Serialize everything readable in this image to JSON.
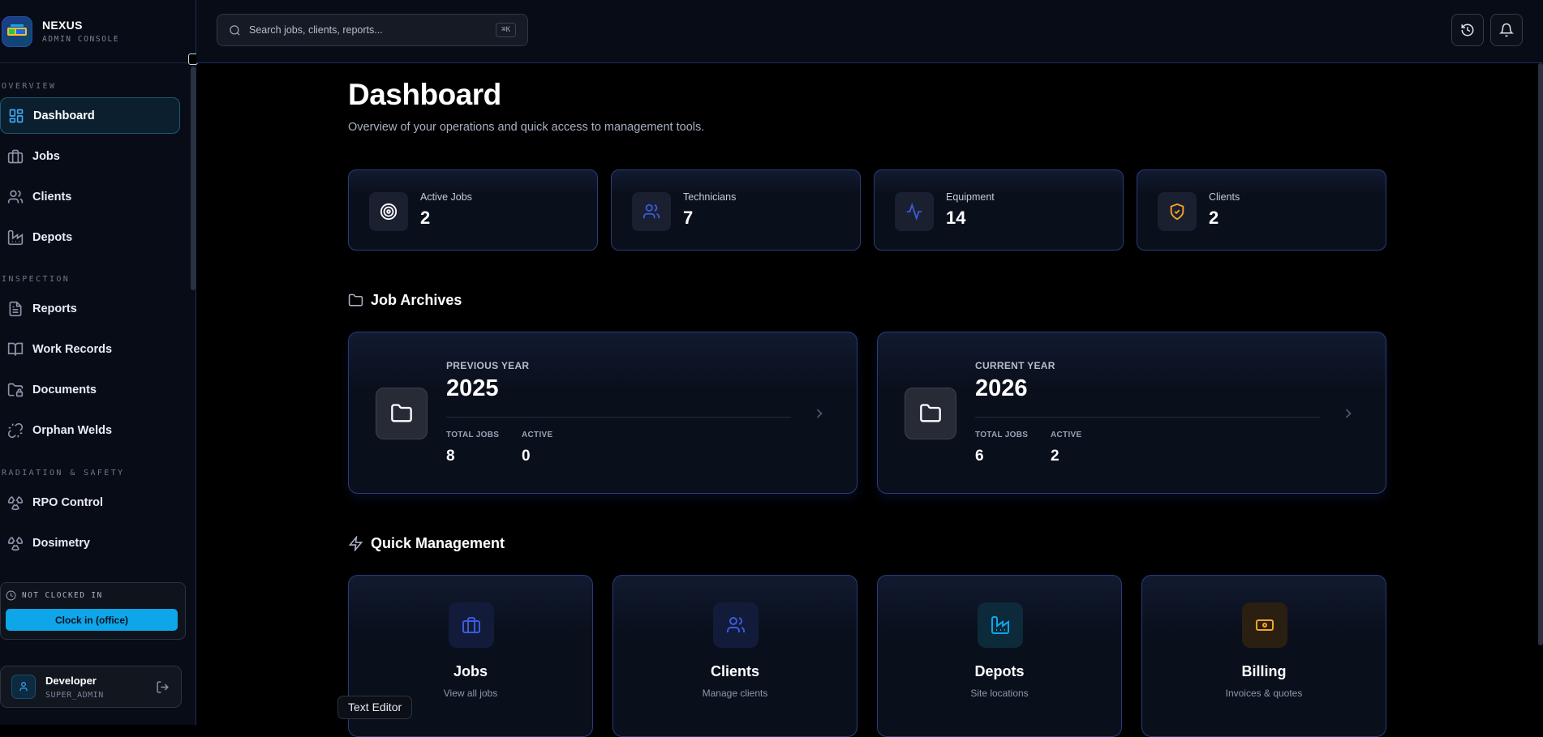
{
  "brand": {
    "name": "NEXUS",
    "subtitle": "ADMIN CONSOLE"
  },
  "sidebar": {
    "sections": [
      {
        "label": "OVERVIEW",
        "items": [
          {
            "label": "Dashboard",
            "icon": "layout-grid-icon",
            "active": true
          },
          {
            "label": "Jobs",
            "icon": "briefcase-icon"
          },
          {
            "label": "Clients",
            "icon": "users-icon"
          },
          {
            "label": "Depots",
            "icon": "factory-icon"
          }
        ]
      },
      {
        "label": "INSPECTION",
        "items": [
          {
            "label": "Reports",
            "icon": "file-text-icon"
          },
          {
            "label": "Work Records",
            "icon": "book-open-icon"
          },
          {
            "label": "Documents",
            "icon": "folder-lock-icon"
          },
          {
            "label": "Orphan Welds",
            "icon": "unlink-icon"
          }
        ]
      },
      {
        "label": "RADIATION & SAFETY",
        "items": [
          {
            "label": "RPO Control",
            "icon": "radiation-icon"
          },
          {
            "label": "Dosimetry",
            "icon": "radiation-icon"
          }
        ]
      }
    ],
    "clock": {
      "status": "NOT CLOCKED IN",
      "button": "Clock in (office)"
    },
    "user": {
      "name": "Developer",
      "role": "SUPER_ADMIN"
    }
  },
  "topbar": {
    "search_placeholder": "Search jobs, clients, reports...",
    "shortcut": "⌘K"
  },
  "main": {
    "title": "Dashboard",
    "subtitle": "Overview of your operations and quick access to management tools.",
    "stats": [
      {
        "label": "Active Jobs",
        "value": "2",
        "icon": "target-icon",
        "color": "#ffffff"
      },
      {
        "label": "Technicians",
        "value": "7",
        "icon": "users-icon",
        "color": "#3b5bdb"
      },
      {
        "label": "Equipment",
        "value": "14",
        "icon": "activity-icon",
        "color": "#3b5bdb"
      },
      {
        "label": "Clients",
        "value": "2",
        "icon": "shield-check-icon",
        "color": "#f5a524"
      }
    ],
    "archives": {
      "heading": "Job Archives",
      "cards": [
        {
          "label": "PREVIOUS YEAR",
          "year": "2025",
          "total_label": "TOTAL JOBS",
          "total": "8",
          "active_label": "ACTIVE",
          "active": "0"
        },
        {
          "label": "CURRENT YEAR",
          "year": "2026",
          "total_label": "TOTAL JOBS",
          "total": "6",
          "active_label": "ACTIVE",
          "active": "2"
        }
      ]
    },
    "quick": {
      "heading": "Quick Management",
      "cards": [
        {
          "title": "Jobs",
          "subtitle": "View all jobs",
          "icon": "briefcase-icon",
          "color": "#3b5bdb"
        },
        {
          "title": "Clients",
          "subtitle": "Manage clients",
          "icon": "users-icon",
          "color": "#3b5bdb"
        },
        {
          "title": "Depots",
          "subtitle": "Site locations",
          "icon": "factory-icon",
          "color": "#0ea5e9"
        },
        {
          "title": "Billing",
          "subtitle": "Invoices & quotes",
          "icon": "banknote-icon",
          "color": "#f5a524"
        }
      ]
    }
  },
  "tooltip": "Text Editor"
}
